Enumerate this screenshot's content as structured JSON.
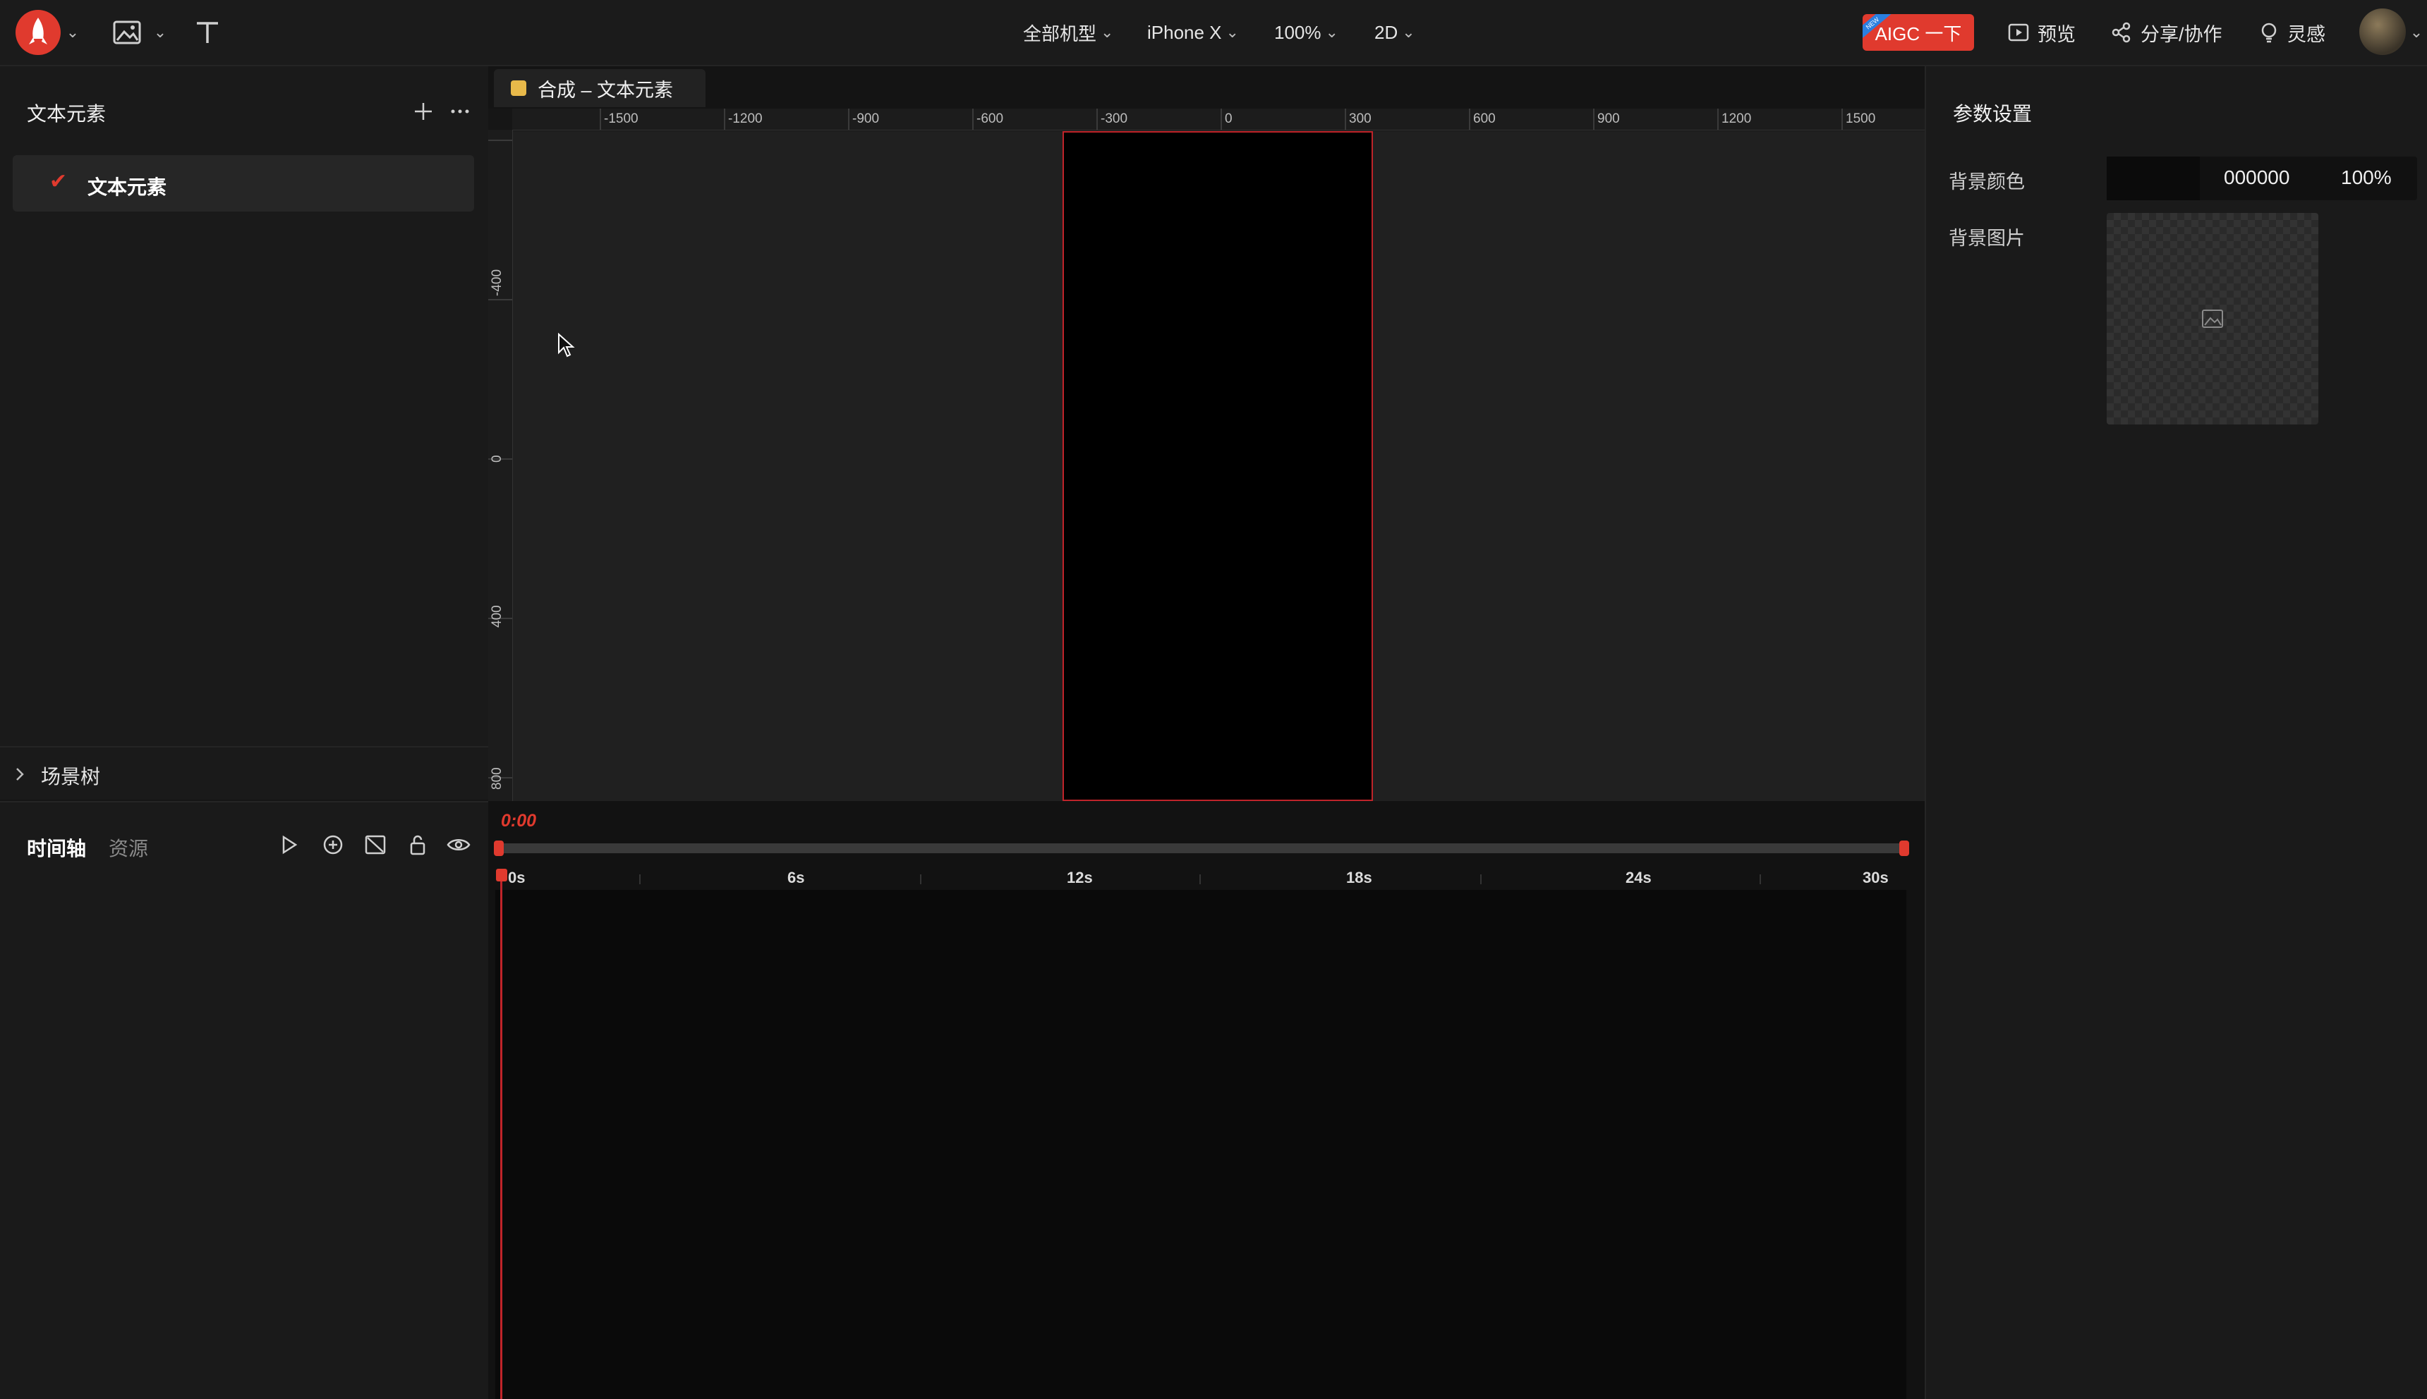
{
  "topbar": {
    "device_label": "全部机型",
    "model_label": "iPhone X",
    "zoom_label": "100%",
    "mode_label": "2D",
    "aigc_label": "AIGC 一下",
    "aigc_ribbon": "NEW",
    "preview_label": "预览",
    "share_label": "分享/协作",
    "inspire_label": "灵感"
  },
  "left": {
    "title": "文本元素",
    "layer_label": "文本元素",
    "scene_tree_label": "场景树"
  },
  "canvas": {
    "tab_label": "合成 – 文本元素",
    "ruler_x": [
      "-1500",
      "-1200",
      "-900",
      "-600",
      "-300",
      "0",
      "300",
      "600",
      "900",
      "1200",
      "1500"
    ],
    "ruler_y": [
      "-400",
      "0",
      "400",
      "800"
    ]
  },
  "params": {
    "title": "参数设置",
    "bg_color_label": "背景颜色",
    "bg_color_hex": "000000",
    "bg_color_alpha": "100%",
    "bg_image_label": "背景图片"
  },
  "timeline": {
    "tab_timeline": "时间轴",
    "tab_assets": "资源",
    "current_time": "0:00",
    "marks": [
      "0s",
      "6s",
      "12s",
      "18s",
      "24s",
      "30s"
    ]
  },
  "colors": {
    "accent": "#e03a2e",
    "artboard_border": "#c0242a",
    "tab_dot": "#e8b94a"
  }
}
